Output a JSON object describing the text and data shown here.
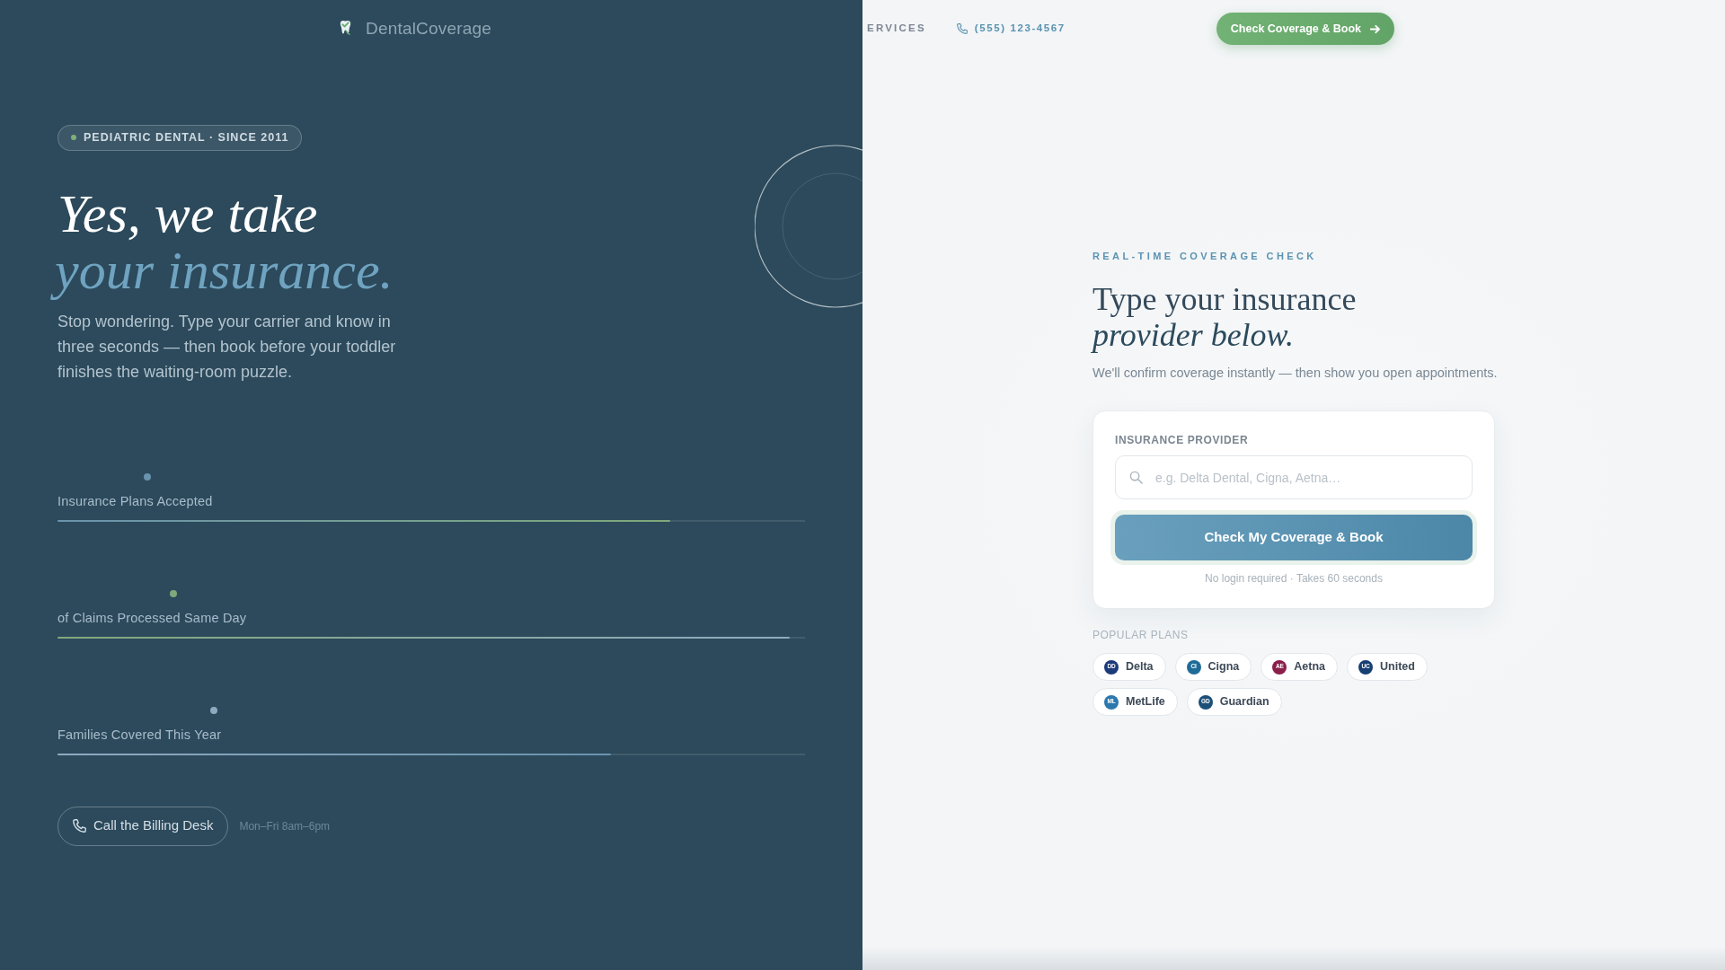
{
  "header": {
    "logo_text": "DentalCoverage",
    "nav_items": [
      "ERVICES"
    ],
    "phone": "(555) 123-4567",
    "cta": "Check Coverage & Book"
  },
  "hero": {
    "badge": "PEDIATRIC DENTAL · SINCE 2011",
    "title_line_1": "Yes, we take",
    "title_line_2": "your insurance.",
    "description": "Stop wondering. Type your carrier and know in three seconds — then book before your toddler finishes the waiting-room puzzle.",
    "stats": [
      {
        "label": "Insurance Plans Accepted",
        "level": 0.82,
        "color": "#6a93ad"
      },
      {
        "label": "of Claims Processed Same Day",
        "level": 0.98,
        "color": "#7fa97a"
      },
      {
        "label": "Families Covered This Year",
        "level": 0.74,
        "color": "#8eaac0"
      }
    ],
    "billing_button": "Call the Billing Desk",
    "billing_hours": "Mon–Fri 8am–6pm"
  },
  "coverage": {
    "eyebrow": "REAL-TIME COVERAGE CHECK",
    "title_line_1": "Type your insurance",
    "title_line_2": "provider below.",
    "subtitle": "We'll confirm coverage instantly — then show you open appointments.",
    "form": {
      "label": "INSURANCE PROVIDER",
      "placeholder": "e.g. Delta Dental, Cigna, Aetna…",
      "submit": "Check My Coverage & Book",
      "note": "No login required · Takes 60 seconds"
    },
    "popular_label": "POPULAR PLANS",
    "plans": [
      {
        "initials": "DD",
        "name": "Delta",
        "color": "#1b3a7a"
      },
      {
        "initials": "CI",
        "name": "Cigna",
        "color": "#1f6b98"
      },
      {
        "initials": "AE",
        "name": "Aetna",
        "color": "#8a1f4b"
      },
      {
        "initials": "UC",
        "name": "United",
        "color": "#173f72"
      },
      {
        "initials": "ML",
        "name": "MetLife",
        "color": "#2b78ad"
      },
      {
        "initials": "GD",
        "name": "Guardian",
        "color": "#1c4f78"
      }
    ]
  }
}
